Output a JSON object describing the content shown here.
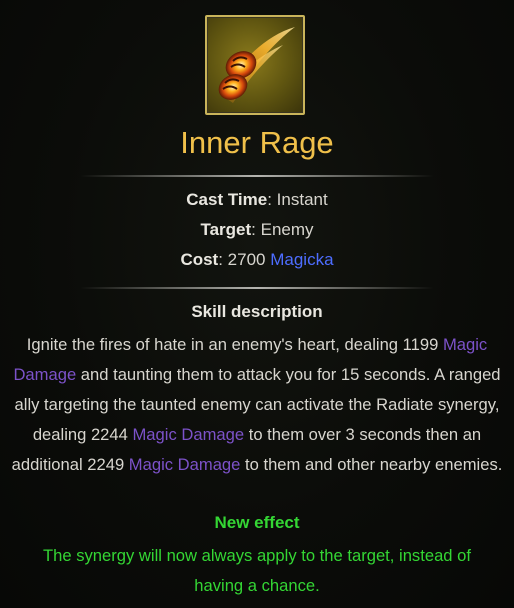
{
  "skill": {
    "icon": "flaming-fists-icon",
    "name": "Inner Rage"
  },
  "stats": [
    {
      "label": "Cast Time",
      "value": "Instant"
    },
    {
      "label": "Target",
      "value": "Enemy"
    },
    {
      "label": "Cost",
      "value": "2700",
      "resource": "Magicka"
    }
  ],
  "description": {
    "heading": "Skill description",
    "segments": [
      {
        "text": "Ignite the fires of hate in an enemy's heart, dealing 1199 "
      },
      {
        "text": "Magic Damage",
        "type": "damage"
      },
      {
        "text": " and taunting them to attack you for 15 seconds. A ranged ally targeting the taunted enemy can activate the Radiate synergy, dealing 2244 "
      },
      {
        "text": "Magic Damage",
        "type": "damage"
      },
      {
        "text": " to them over 3 seconds then an additional 2249 "
      },
      {
        "text": "Magic Damage",
        "type": "damage"
      },
      {
        "text": " to them and other nearby enemies."
      }
    ]
  },
  "new_effect": {
    "heading": "New effect",
    "text": "The synergy will now always apply to the target, instead of having a chance."
  },
  "colors": {
    "title": "#f0c04a",
    "magicka": "#4d6dff",
    "magic_damage": "#7c52c9",
    "new_effect": "#34d634"
  }
}
